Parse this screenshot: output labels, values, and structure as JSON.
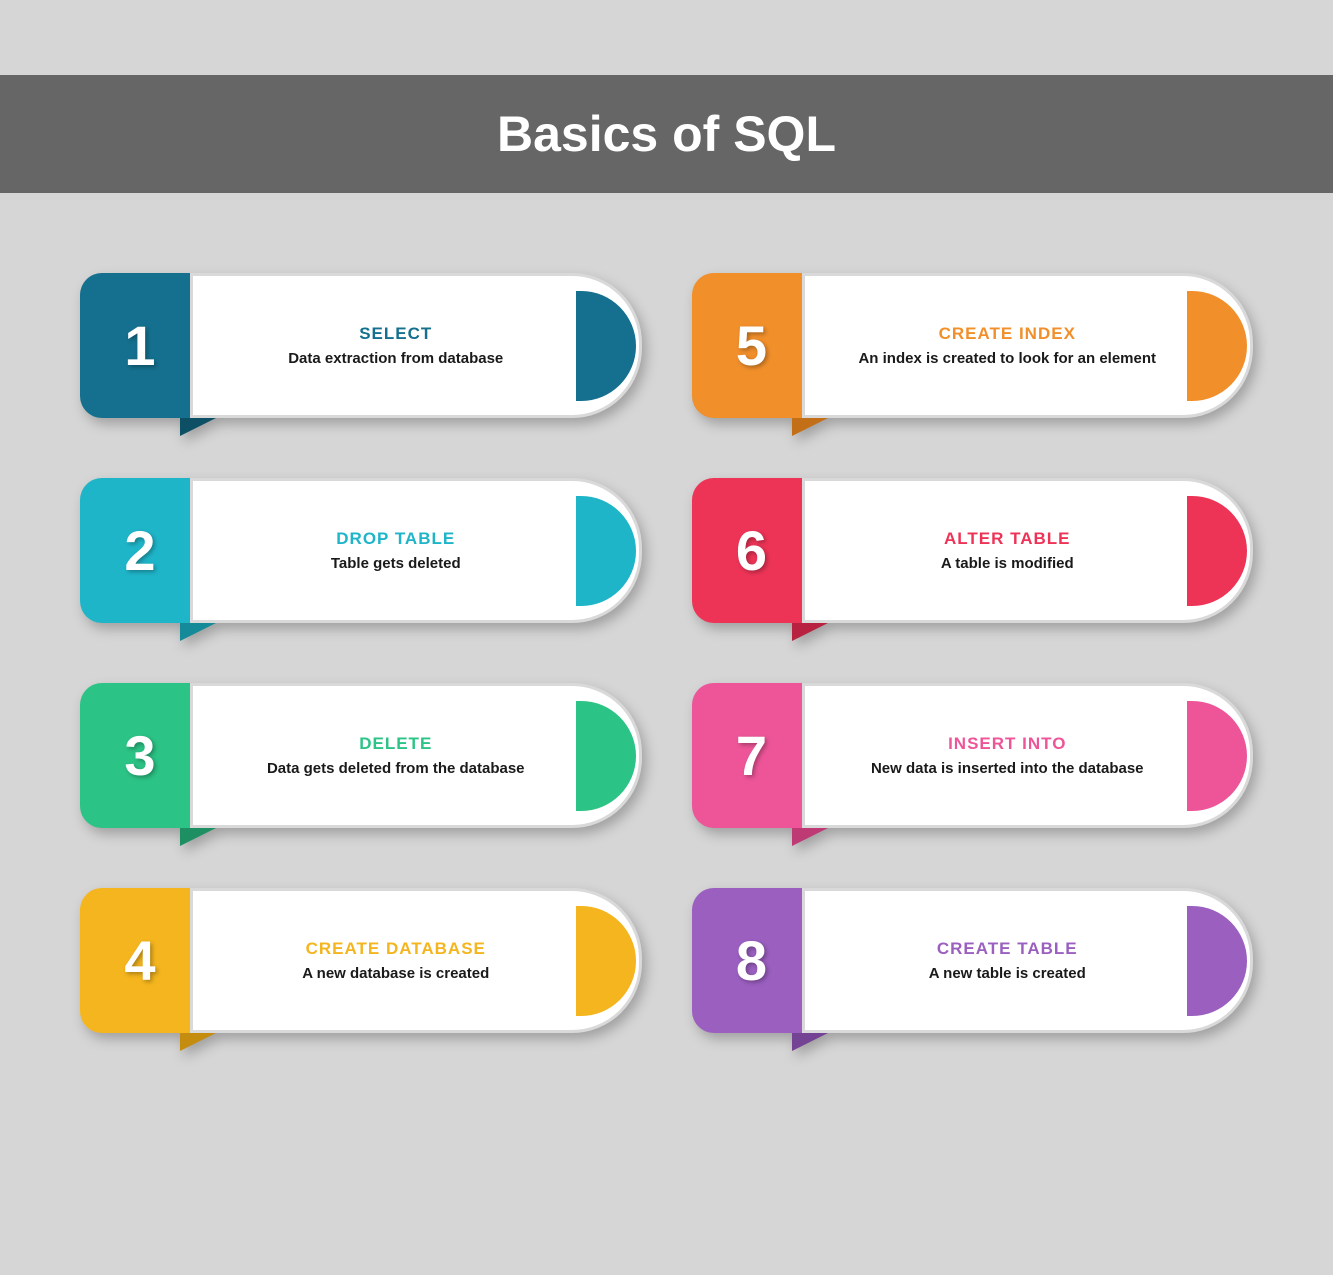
{
  "title": "Basics of SQL",
  "items": [
    {
      "n": "1",
      "cmd": "SELECT",
      "desc": "Data extraction from database",
      "color": "#14708e",
      "dark": "#0d4f64"
    },
    {
      "n": "2",
      "cmd": "DROP TABLE",
      "desc": "Table gets deleted",
      "color": "#1fb5c9",
      "dark": "#158a99"
    },
    {
      "n": "3",
      "cmd": "DELETE",
      "desc": "Data gets deleted from the database",
      "color": "#2cc386",
      "dark": "#1e8f62"
    },
    {
      "n": "4",
      "cmd": "CREATE DATABASE",
      "desc": "A new database is created",
      "color": "#f4b51e",
      "dark": "#c48d10"
    },
    {
      "n": "5",
      "cmd": "CREATE INDEX",
      "desc": "An index is created to look for an element",
      "color": "#f18f2b",
      "dark": "#c26f18"
    },
    {
      "n": "6",
      "cmd": "ALTER TABLE",
      "desc": "A table is modified",
      "color": "#ed3457",
      "dark": "#b8213f"
    },
    {
      "n": "7",
      "cmd": "INSERT INTO",
      "desc": "New data is inserted into the database",
      "color": "#ed5598",
      "dark": "#bd3a74"
    },
    {
      "n": "8",
      "cmd": "CREATE TABLE",
      "desc": "A new table is created",
      "color": "#9b5fc0",
      "dark": "#754394"
    }
  ]
}
